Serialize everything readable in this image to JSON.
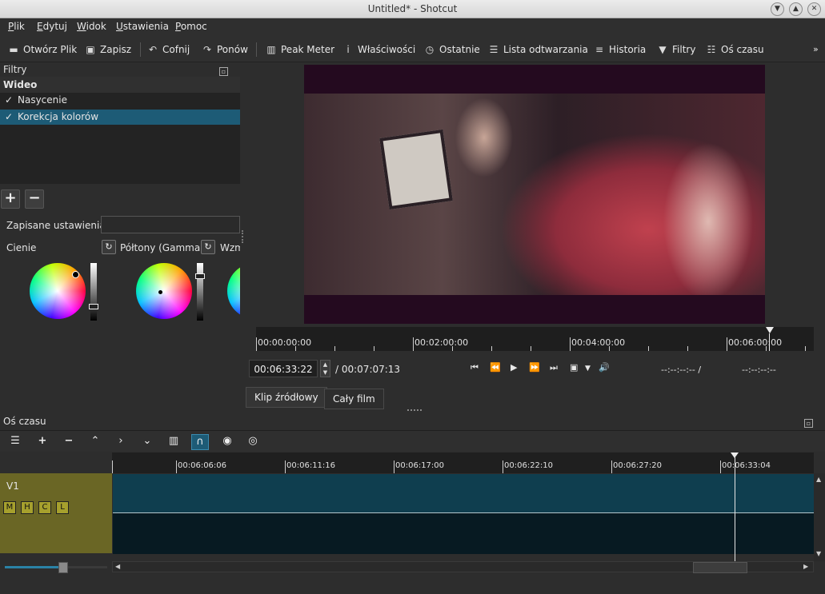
{
  "window": {
    "title": "Untitled* - Shotcut"
  },
  "menu": [
    "Plik",
    "Edytuj",
    "Widok",
    "Ustawienia",
    "Pomoc"
  ],
  "toolbar": {
    "open": "Otwórz Plik",
    "save": "Zapisz",
    "undo": "Cofnij",
    "redo": "Ponów",
    "peak": "Peak Meter",
    "properties": "Właściwości",
    "recent": "Ostatnie",
    "playlist": "Lista odtwarzania",
    "history": "Historia",
    "filters": "Filtry",
    "timeline": "Oś czasu"
  },
  "filters_panel": {
    "title": "Filtry",
    "section": "Wideo",
    "items": [
      {
        "label": "Nasycenie",
        "checked": true,
        "selected": false
      },
      {
        "label": "Korekcja kolorów",
        "checked": true,
        "selected": true
      }
    ],
    "preset_label": "Zapisane ustawienia",
    "wheels": [
      "Cienie",
      "Półtony (Gamma)",
      "Wzm"
    ]
  },
  "player": {
    "ruler_labels": [
      "00:00:00:00",
      "00:02:00:00",
      "00:04:00:00",
      "00:06:00:00"
    ],
    "position": "00:06:33:22",
    "duration": "/ 00:07:07:13",
    "in_point": "--:--:--:-- /",
    "out_point": "--:--:--:--",
    "tabs": [
      "Klip źródłowy",
      "Cały film"
    ]
  },
  "timeline": {
    "title": "Oś czasu",
    "ruler_labels": [
      "00:06:06:06",
      "00:06:11:16",
      "00:06:17:00",
      "00:06:22:10",
      "00:06:27:20",
      "00:06:33:04"
    ],
    "track_name": "V1",
    "track_buttons": [
      "M",
      "H",
      "C",
      "L"
    ],
    "zoom_level": 0.55
  },
  "colors": {
    "accent": "#1d5b76",
    "clip": "#0f3e4f",
    "track_header": "#6a6625"
  }
}
